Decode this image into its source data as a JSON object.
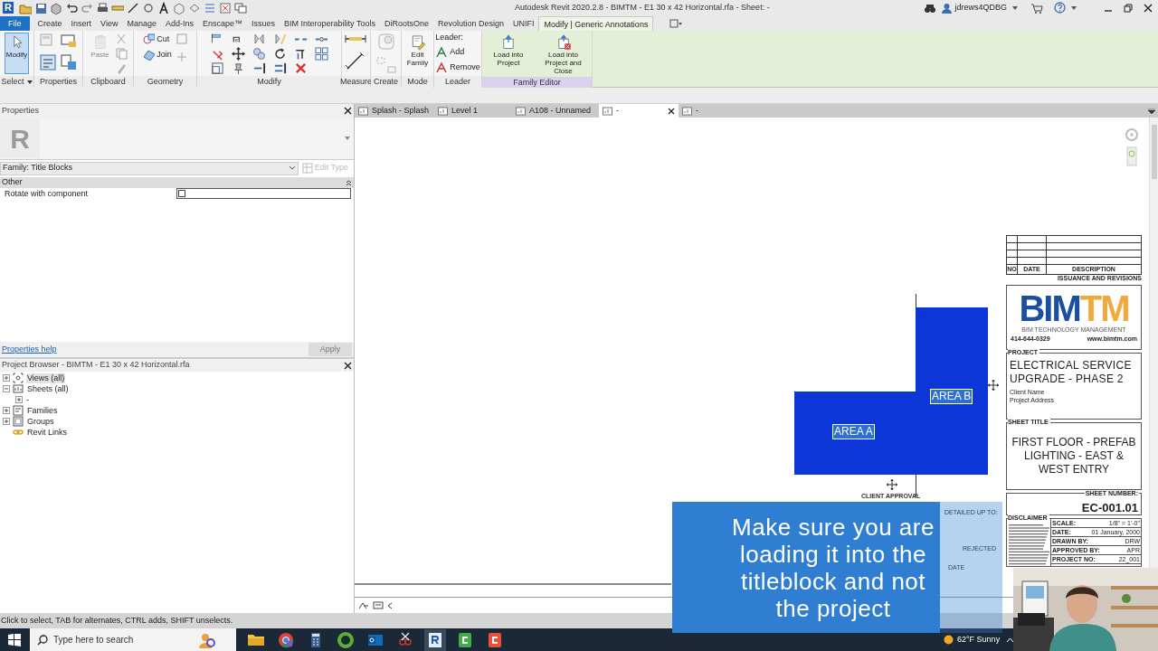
{
  "title_bar": {
    "logo": "R",
    "title": "Autodesk Revit 2020.2.8 - BIMTM - E1 30 x 42 Horizontal.rfa - Sheet: -",
    "user": "jdrews4QDBG"
  },
  "ribbon_tabs": [
    {
      "label": "File",
      "selected": false,
      "kind": "application"
    },
    {
      "label": "Create",
      "selected": false,
      "kind": "tab"
    },
    {
      "label": "Insert",
      "selected": false,
      "kind": "tab"
    },
    {
      "label": "View",
      "selected": false,
      "kind": "tab"
    },
    {
      "label": "Manage",
      "selected": false,
      "kind": "tab"
    },
    {
      "label": "Add-Ins",
      "selected": false,
      "kind": "tab"
    },
    {
      "label": "Enscape™",
      "selected": false,
      "kind": "tab"
    },
    {
      "label": "Issues",
      "selected": false,
      "kind": "tab"
    },
    {
      "label": "BIM Interoperability Tools",
      "selected": false,
      "kind": "tab"
    },
    {
      "label": "DiRootsOne",
      "selected": false,
      "kind": "tab"
    },
    {
      "label": "Revolution Design",
      "selected": false,
      "kind": "tab"
    },
    {
      "label": "UNIFI",
      "selected": false,
      "kind": "tab"
    },
    {
      "label": "Modify | Generic Annotations",
      "selected": true,
      "kind": "tab"
    }
  ],
  "ribbon_panels": [
    {
      "label": "Select",
      "dropdown": true,
      "contextual": false,
      "controls": [
        {
          "kind": "large",
          "label": "Modify",
          "active": true,
          "disabled": false
        }
      ]
    },
    {
      "label": "Properties",
      "dropdown": false,
      "contextual": false
    },
    {
      "label": "Clipboard",
      "dropdown": false,
      "contextual": false,
      "controls": [
        {
          "kind": "large",
          "label": "Paste",
          "active": false,
          "disabled": true
        }
      ]
    },
    {
      "label": "Geometry",
      "dropdown": false,
      "contextual": false,
      "controls": [
        {
          "kind": "small",
          "label": "Cut",
          "active": false,
          "disabled": false
        },
        {
          "kind": "small",
          "label": "Join",
          "active": false,
          "disabled": false
        }
      ]
    },
    {
      "label": "Modify",
      "dropdown": false,
      "contextual": false
    },
    {
      "label": "Measure",
      "dropdown": false,
      "contextual": false
    },
    {
      "label": "Create",
      "dropdown": false,
      "contextual": false
    },
    {
      "label": "Mode",
      "dropdown": false,
      "contextual": false,
      "controls": [
        {
          "kind": "large",
          "label": "Edit Family",
          "active": false,
          "disabled": false
        }
      ]
    },
    {
      "label": "Leader",
      "dropdown": false,
      "contextual": false,
      "controls": [
        {
          "kind": "heading",
          "label": "Leader:"
        },
        {
          "kind": "small",
          "label": "Add",
          "active": false,
          "disabled": false
        },
        {
          "kind": "small",
          "label": "Remove",
          "active": false,
          "disabled": false
        }
      ]
    },
    {
      "label": "Family Editor",
      "dropdown": false,
      "contextual": true,
      "controls": [
        {
          "kind": "large",
          "label": "Load into Project",
          "active": false,
          "disabled": false
        },
        {
          "kind": "large",
          "label": "Load into Project and Close",
          "active": false,
          "disabled": false
        }
      ]
    }
  ],
  "properties": {
    "title": "Properties",
    "type_preview": "R",
    "type_selector": "Family: Title Blocks",
    "edit_type": {
      "label": "Edit Type",
      "disabled": true
    },
    "group": "Other",
    "parameters": [
      {
        "name": "Rotate with component",
        "checked": false
      }
    ],
    "help_link": "Properties help",
    "apply": {
      "label": "Apply",
      "disabled": true
    }
  },
  "project_browser": {
    "title": "Project Browser - BIMTM - E1 30 x 42 Horizontal.rfa",
    "tree": [
      {
        "label": "Views (all)",
        "kind": "views",
        "selected": true,
        "expandable": true,
        "expanded": false
      },
      {
        "label": "Sheets (all)",
        "kind": "sheets",
        "selected": false,
        "expandable": true,
        "expanded": true,
        "children": [
          {
            "label": "-",
            "selected": false,
            "expandable": true,
            "expanded": false
          }
        ]
      },
      {
        "label": "Families",
        "kind": "families",
        "selected": false,
        "expandable": true,
        "expanded": false
      },
      {
        "label": "Groups",
        "kind": "groups",
        "selected": false,
        "expandable": true,
        "expanded": false
      },
      {
        "label": "Revit Links",
        "kind": "links",
        "selected": false,
        "expandable": false
      }
    ]
  },
  "view_tabs": [
    {
      "label": "Splash - Splash",
      "selected": false
    },
    {
      "label": "Level 1",
      "selected": false
    },
    {
      "label": "A108 - Unnamed",
      "selected": false
    },
    {
      "label": "-",
      "selected": true
    },
    {
      "label": "-",
      "selected": false
    }
  ],
  "areas": [
    {
      "label": "AREA B"
    },
    {
      "label": "AREA A"
    }
  ],
  "approval_block": {
    "title": "CLIENT APPROVAL",
    "detailed_up_to": "DETAILED UP TO:",
    "rejected": "REJECTED",
    "date": "DATE"
  },
  "title_block": {
    "revisions": {
      "columns": [
        "NO",
        "DATE",
        "DESCRIPTION"
      ],
      "caption": "ISSUANCE AND REVISIONS"
    },
    "logo": {
      "mark_left": "BIM",
      "mark_right": "TM",
      "tagline": "BIM TECHNOLOGY MANAGEMENT",
      "phone": "414-644-0329",
      "website": "www.bimtm.com"
    },
    "project": {
      "label": "PROJECT",
      "name": "ELECTRICAL SERVICE UPGRADE - PHASE 2",
      "client": "Client Name",
      "address": "Project Address"
    },
    "sheet_title": {
      "label": "SHEET TITLE",
      "text": "FIRST FLOOR - PREFAB LIGHTING - EAST & WEST ENTRY"
    },
    "sheet_number": {
      "label": "SHEET NUMBER:",
      "value": "EC-001.01"
    },
    "disclaimer": {
      "label": "DISCLAIMER"
    },
    "info": [
      {
        "label": "SCALE:",
        "value": "1/8\" = 1'-0\""
      },
      {
        "label": "DATE:",
        "value": "01 January, 2000"
      },
      {
        "label": "DRAWN BY:",
        "value": "DRW"
      },
      {
        "label": "APPROVED BY:",
        "value": "APR"
      },
      {
        "label": "PROJECT NO:",
        "value": "22_001"
      }
    ]
  },
  "status_bar": "Click to select, TAB for alternates, CTRL adds, SHIFT unselects.",
  "taskbar": {
    "search_placeholder": "Type here to search",
    "weather": "62°F Sunny"
  },
  "caption": "Make sure you are loading it into the titleblock and not the project"
}
